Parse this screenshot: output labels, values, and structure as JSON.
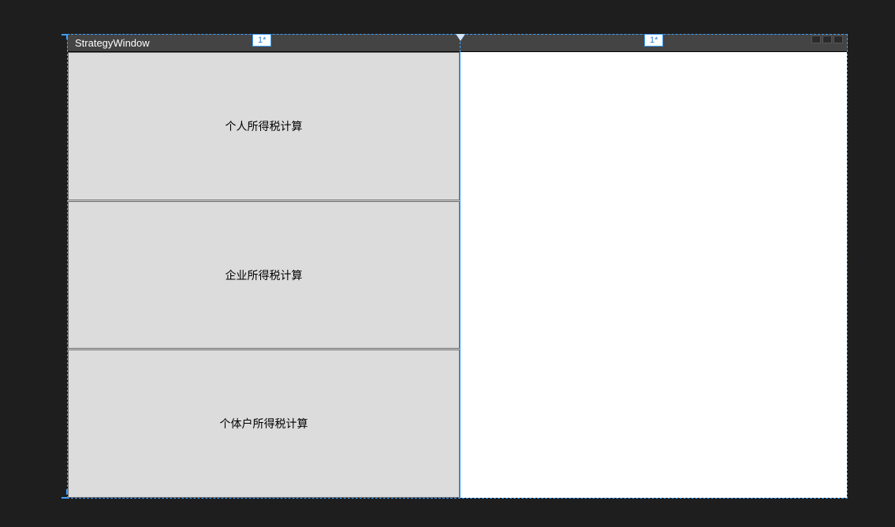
{
  "designer": {
    "window_title": "StrategyWindow",
    "column_labels": {
      "left": "1*",
      "right": "1*"
    }
  },
  "buttons": {
    "personal_tax": "个人所得税计算",
    "corporate_tax": "企业所得税计算",
    "individual_business_tax": "个体户所得税计算"
  }
}
